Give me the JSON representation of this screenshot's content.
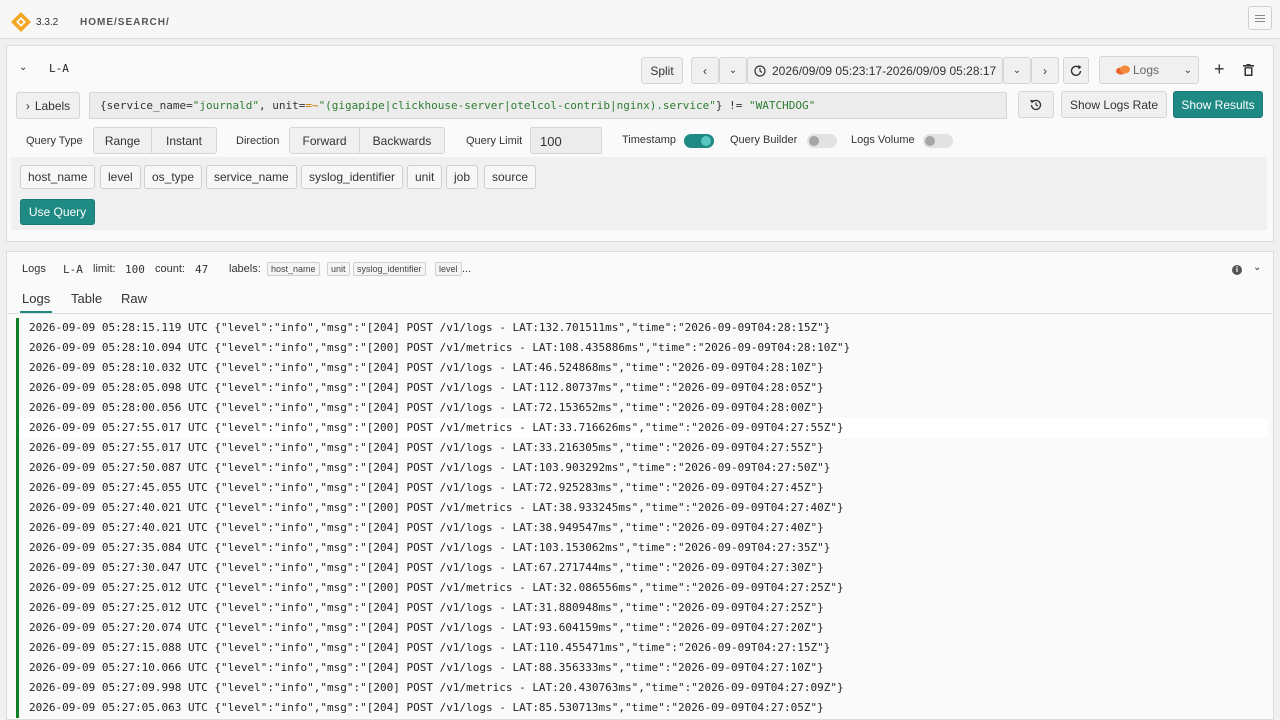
{
  "app": {
    "version": "3.3.2",
    "breadcrumb": "HOME/SEARCH/"
  },
  "colors": {
    "accent": "#1f8a84",
    "log_bar": "#0f7d23",
    "string": "#2e7d32",
    "operator": "#c77700"
  },
  "query": {
    "name": "L-A",
    "split_label": "Split",
    "time_range": "2026/09/09 05:23:17-2026/09/09 05:28:17",
    "datasource": "Logs",
    "labels_button": "Labels",
    "expr": {
      "p1": "{service_name=",
      "p2": "\"journald\"",
      "p3": ", unit=",
      "p4": "=~",
      "p5": "\"(gigapipe|clickhouse-server|otelcol-contrib|nginx).service\"",
      "p6": "} != ",
      "p7": "\"WATCHDOG\""
    },
    "show_logs_rate": "Show Logs Rate",
    "show_results": "Show Results",
    "query_type_label": "Query Type",
    "query_type_options": [
      "Range",
      "Instant"
    ],
    "direction_label": "Direction",
    "direction_options": [
      "Forward",
      "Backwards"
    ],
    "query_limit_label": "Query Limit",
    "query_limit_value": "100",
    "timestamp_label": "Timestamp",
    "timestamp_on": true,
    "query_builder_label": "Query Builder",
    "query_builder_on": false,
    "logs_volume_label": "Logs Volume",
    "logs_volume_on": false,
    "label_chips": [
      "host_name",
      "level",
      "os_type",
      "service_name",
      "syslog_identifier",
      "unit",
      "job",
      "source"
    ],
    "use_query": "Use Query"
  },
  "logs": {
    "title": "Logs",
    "query_name": "L-A",
    "limit_label": "limit:",
    "limit_value": "100",
    "count_label": "count:",
    "count_value": "47",
    "labels_label": "labels:",
    "labels": [
      "host_name",
      "unit",
      "syslog_identifier",
      "level"
    ],
    "more": "...",
    "tabs": [
      "Logs",
      "Table",
      "Raw"
    ],
    "rows": [
      "2026-09-09 05:28:15.119 UTC {\"level\":\"info\",\"msg\":\"[204] POST /v1/logs - LAT:132.701511ms\",\"time\":\"2026-09-09T04:28:15Z\"}",
      "2026-09-09 05:28:10.094 UTC {\"level\":\"info\",\"msg\":\"[200] POST /v1/metrics - LAT:108.435886ms\",\"time\":\"2026-09-09T04:28:10Z\"}",
      "2026-09-09 05:28:10.032 UTC {\"level\":\"info\",\"msg\":\"[204] POST /v1/logs - LAT:46.524868ms\",\"time\":\"2026-09-09T04:28:10Z\"}",
      "2026-09-09 05:28:05.098 UTC {\"level\":\"info\",\"msg\":\"[204] POST /v1/logs - LAT:112.80737ms\",\"time\":\"2026-09-09T04:28:05Z\"}",
      "2026-09-09 05:28:00.056 UTC {\"level\":\"info\",\"msg\":\"[204] POST /v1/logs - LAT:72.153652ms\",\"time\":\"2026-09-09T04:28:00Z\"}",
      "2026-09-09 05:27:55.017 UTC {\"level\":\"info\",\"msg\":\"[200] POST /v1/metrics - LAT:33.716626ms\",\"time\":\"2026-09-09T04:27:55Z\"}",
      "2026-09-09 05:27:55.017 UTC {\"level\":\"info\",\"msg\":\"[204] POST /v1/logs - LAT:33.216305ms\",\"time\":\"2026-09-09T04:27:55Z\"}",
      "2026-09-09 05:27:50.087 UTC {\"level\":\"info\",\"msg\":\"[204] POST /v1/logs - LAT:103.903292ms\",\"time\":\"2026-09-09T04:27:50Z\"}",
      "2026-09-09 05:27:45.055 UTC {\"level\":\"info\",\"msg\":\"[204] POST /v1/logs - LAT:72.925283ms\",\"time\":\"2026-09-09T04:27:45Z\"}",
      "2026-09-09 05:27:40.021 UTC {\"level\":\"info\",\"msg\":\"[200] POST /v1/metrics - LAT:38.933245ms\",\"time\":\"2026-09-09T04:27:40Z\"}",
      "2026-09-09 05:27:40.021 UTC {\"level\":\"info\",\"msg\":\"[204] POST /v1/logs - LAT:38.949547ms\",\"time\":\"2026-09-09T04:27:40Z\"}",
      "2026-09-09 05:27:35.084 UTC {\"level\":\"info\",\"msg\":\"[204] POST /v1/logs - LAT:103.153062ms\",\"time\":\"2026-09-09T04:27:35Z\"}",
      "2026-09-09 05:27:30.047 UTC {\"level\":\"info\",\"msg\":\"[204] POST /v1/logs - LAT:67.271744ms\",\"time\":\"2026-09-09T04:27:30Z\"}",
      "2026-09-09 05:27:25.012 UTC {\"level\":\"info\",\"msg\":\"[200] POST /v1/metrics - LAT:32.086556ms\",\"time\":\"2026-09-09T04:27:25Z\"}",
      "2026-09-09 05:27:25.012 UTC {\"level\":\"info\",\"msg\":\"[204] POST /v1/logs - LAT:31.880948ms\",\"time\":\"2026-09-09T04:27:25Z\"}",
      "2026-09-09 05:27:20.074 UTC {\"level\":\"info\",\"msg\":\"[204] POST /v1/logs - LAT:93.604159ms\",\"time\":\"2026-09-09T04:27:20Z\"}",
      "2026-09-09 05:27:15.088 UTC {\"level\":\"info\",\"msg\":\"[204] POST /v1/logs - LAT:110.455471ms\",\"time\":\"2026-09-09T04:27:15Z\"}",
      "2026-09-09 05:27:10.066 UTC {\"level\":\"info\",\"msg\":\"[204] POST /v1/logs - LAT:88.356333ms\",\"time\":\"2026-09-09T04:27:10Z\"}",
      "2026-09-09 05:27:09.998 UTC {\"level\":\"info\",\"msg\":\"[200] POST /v1/metrics - LAT:20.430763ms\",\"time\":\"2026-09-09T04:27:09Z\"}",
      "2026-09-09 05:27:05.063 UTC {\"level\":\"info\",\"msg\":\"[204] POST /v1/logs - LAT:85.530713ms\",\"time\":\"2026-09-09T04:27:05Z\"}"
    ]
  }
}
